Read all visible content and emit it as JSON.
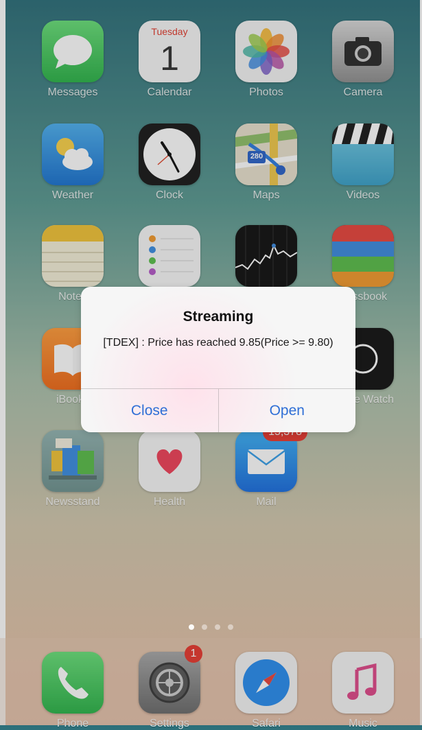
{
  "alert": {
    "title": "Streaming",
    "message": "[TDEX] : Price has reached 9.85(Price >= 9.80)",
    "close_label": "Close",
    "open_label": "Open"
  },
  "apps": {
    "messages": "Messages",
    "calendar": "Calendar",
    "calendar_day": "Tuesday",
    "calendar_date": "1",
    "photos": "Photos",
    "camera": "Camera",
    "weather": "Weather",
    "clock": "Clock",
    "maps": "Maps",
    "maps_shield": "280",
    "videos": "Videos",
    "notes": "Notes",
    "passbook": "Passbook",
    "ibooks": "iBooks",
    "watch": "Apple Watch",
    "newsstand": "Newsstand",
    "health": "Health",
    "mail": "Mail",
    "mail_badge": "15,378"
  },
  "dock": {
    "phone": "Phone",
    "settings": "Settings",
    "settings_badge": "1",
    "safari": "Safari",
    "music": "Music"
  },
  "page_indicator": {
    "pages": 4,
    "current": 1
  },
  "colors": {
    "accent": "#2f6fd6",
    "badge": "#e83a30"
  }
}
